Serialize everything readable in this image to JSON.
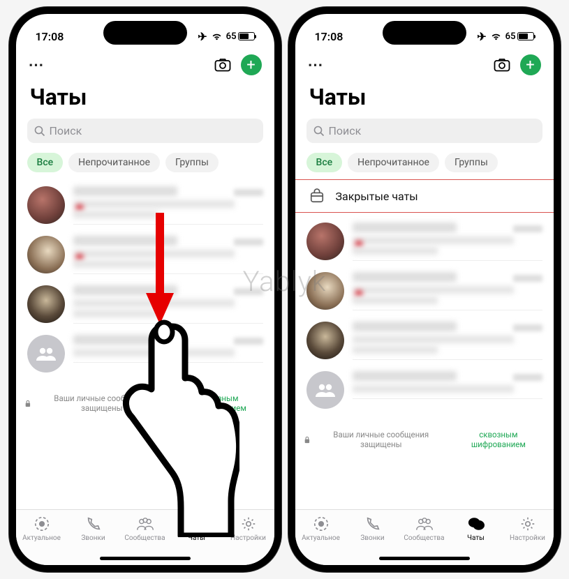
{
  "status": {
    "time": "17:08",
    "battery_text": "65"
  },
  "header": {
    "page_title": "Чаты"
  },
  "search": {
    "placeholder": "Поиск"
  },
  "filters": {
    "all": "Все",
    "unread": "Непрочитанное",
    "groups": "Группы"
  },
  "locked_chats": {
    "label": "Закрытые чаты"
  },
  "encryption": {
    "prefix": "Ваши личные сообщения защищены ",
    "link": "сквозным шифрованием"
  },
  "tabs": {
    "updates": "Актуальное",
    "calls": "Звонки",
    "communities": "Сообщества",
    "chats": "Чаты",
    "settings": "Настройки"
  },
  "watermark": "Yablyk"
}
